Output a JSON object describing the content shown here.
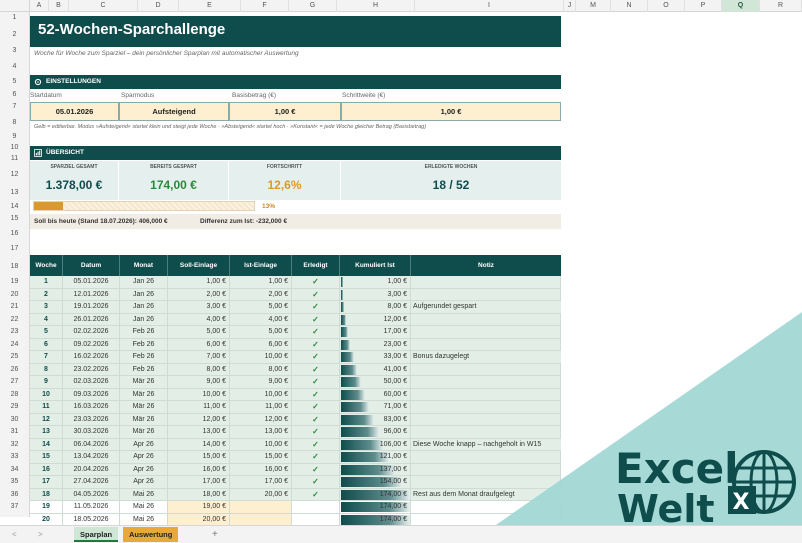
{
  "columns": [
    "A",
    "B",
    "C",
    "D",
    "E",
    "F",
    "G",
    "H",
    "I",
    "J",
    "M",
    "N",
    "O",
    "P",
    "Q",
    "R"
  ],
  "selected_column": "Q",
  "rows": [
    "1",
    "2",
    "3",
    "4",
    "5",
    "6",
    "7",
    "8",
    "9",
    "10",
    "11",
    "12",
    "13",
    "14",
    "15",
    "16",
    "17",
    "18",
    "19",
    "20",
    "21",
    "22",
    "23",
    "24",
    "25",
    "26",
    "27",
    "28",
    "29",
    "30",
    "31",
    "32",
    "33",
    "34",
    "35",
    "36",
    "37"
  ],
  "title": "52-Wochen-Sparchallenge",
  "subtitle": "Woche für Woche zum Sparziel – dein persönlicher Sparplan mit automatischer Auswertung",
  "settings": {
    "header": "EINSTELLUNGEN",
    "labels": {
      "start": "Startdatum",
      "mode": "Sparmodus",
      "base": "Basisbetrag (€)",
      "step": "Schrittweite (€)"
    },
    "values": {
      "start": "05.01.2026",
      "mode": "Aufsteigend",
      "base": "1,00 €",
      "step": "1,00 €"
    },
    "hint": "Gelb = editierbar. Modus »Aufsteigend« startet klein und steigt jede Woche · »Absteigend« startet hoch · »Konstant« = jede Woche gleicher Betrag (Basisbetrag)"
  },
  "overview": {
    "header": "ÜBERSICHT",
    "kpis": [
      {
        "label": "SPARZIEL GESAMT",
        "value": "1.378,00 €",
        "color": "#0f4c4c"
      },
      {
        "label": "BEREITS GESPART",
        "value": "174,00 €",
        "color": "#2a8a3a"
      },
      {
        "label": "FORTSCHRITT",
        "value": "12,6%",
        "color": "#d99a2b"
      },
      {
        "label": "ERLEDIGTE WOCHEN",
        "value": "18 / 52",
        "color": "#0f4c4c"
      }
    ],
    "progress": 0.13,
    "progress_label": "13%",
    "soll_text": "Soll bis heute (Stand 18.07.2026):  406,000 €",
    "diff_text": "Differenz zum Ist:  -232,000 €"
  },
  "table": {
    "headers": [
      "Woche",
      "Datum",
      "Monat",
      "Soll-Einlage",
      "Ist-Einlage",
      "Erledigt",
      "Kumuliert Ist",
      "Notiz"
    ],
    "rows": [
      {
        "week": "1",
        "date": "05.01.2026",
        "month": "Jan 26",
        "soll": "1,00 €",
        "ist": "1,00 €",
        "done": "✓",
        "cum": "1,00 €",
        "cum_value": 1,
        "note": ""
      },
      {
        "week": "2",
        "date": "12.01.2026",
        "month": "Jan 26",
        "soll": "2,00 €",
        "ist": "2,00 €",
        "done": "✓",
        "cum": "3,00 €",
        "cum_value": 3,
        "note": ""
      },
      {
        "week": "3",
        "date": "19.01.2026",
        "month": "Jan 26",
        "soll": "3,00 €",
        "ist": "5,00 €",
        "done": "✓",
        "cum": "8,00 €",
        "cum_value": 8,
        "note": "Aufgerundet gespart"
      },
      {
        "week": "4",
        "date": "26.01.2026",
        "month": "Jan 26",
        "soll": "4,00 €",
        "ist": "4,00 €",
        "done": "✓",
        "cum": "12,00 €",
        "cum_value": 12,
        "note": ""
      },
      {
        "week": "5",
        "date": "02.02.2026",
        "month": "Feb 26",
        "soll": "5,00 €",
        "ist": "5,00 €",
        "done": "✓",
        "cum": "17,00 €",
        "cum_value": 17,
        "note": ""
      },
      {
        "week": "6",
        "date": "09.02.2026",
        "month": "Feb 26",
        "soll": "6,00 €",
        "ist": "6,00 €",
        "done": "✓",
        "cum": "23,00 €",
        "cum_value": 23,
        "note": ""
      },
      {
        "week": "7",
        "date": "16.02.2026",
        "month": "Feb 26",
        "soll": "7,00 €",
        "ist": "10,00 €",
        "done": "✓",
        "cum": "33,00 €",
        "cum_value": 33,
        "note": "Bonus dazugelegt"
      },
      {
        "week": "8",
        "date": "23.02.2026",
        "month": "Feb 26",
        "soll": "8,00 €",
        "ist": "8,00 €",
        "done": "✓",
        "cum": "41,00 €",
        "cum_value": 41,
        "note": ""
      },
      {
        "week": "9",
        "date": "02.03.2026",
        "month": "Mär 26",
        "soll": "9,00 €",
        "ist": "9,00 €",
        "done": "✓",
        "cum": "50,00 €",
        "cum_value": 50,
        "note": ""
      },
      {
        "week": "10",
        "date": "09.03.2026",
        "month": "Mär 26",
        "soll": "10,00 €",
        "ist": "10,00 €",
        "done": "✓",
        "cum": "60,00 €",
        "cum_value": 60,
        "note": ""
      },
      {
        "week": "11",
        "date": "16.03.2026",
        "month": "Mär 26",
        "soll": "11,00 €",
        "ist": "11,00 €",
        "done": "✓",
        "cum": "71,00 €",
        "cum_value": 71,
        "note": ""
      },
      {
        "week": "12",
        "date": "23.03.2026",
        "month": "Mär 26",
        "soll": "12,00 €",
        "ist": "12,00 €",
        "done": "✓",
        "cum": "83,00 €",
        "cum_value": 83,
        "note": ""
      },
      {
        "week": "13",
        "date": "30.03.2026",
        "month": "Mär 26",
        "soll": "13,00 €",
        "ist": "13,00 €",
        "done": "✓",
        "cum": "96,00 €",
        "cum_value": 96,
        "note": ""
      },
      {
        "week": "14",
        "date": "06.04.2026",
        "month": "Apr 26",
        "soll": "14,00 €",
        "ist": "10,00 €",
        "done": "✓",
        "cum": "106,00 €",
        "cum_value": 106,
        "note": "Diese Woche knapp – nachgeholt in W15"
      },
      {
        "week": "15",
        "date": "13.04.2026",
        "month": "Apr 26",
        "soll": "15,00 €",
        "ist": "15,00 €",
        "done": "✓",
        "cum": "121,00 €",
        "cum_value": 121,
        "note": ""
      },
      {
        "week": "16",
        "date": "20.04.2026",
        "month": "Apr 26",
        "soll": "16,00 €",
        "ist": "16,00 €",
        "done": "✓",
        "cum": "137,00 €",
        "cum_value": 137,
        "note": ""
      },
      {
        "week": "17",
        "date": "27.04.2026",
        "month": "Apr 26",
        "soll": "17,00 €",
        "ist": "17,00 €",
        "done": "✓",
        "cum": "154,00 €",
        "cum_value": 154,
        "note": ""
      },
      {
        "week": "18",
        "date": "04.05.2026",
        "month": "Mai 26",
        "soll": "18,00 €",
        "ist": "20,00 €",
        "done": "✓",
        "cum": "174,00 €",
        "cum_value": 174,
        "note": "Rest aus dem Monat draufgelegt"
      },
      {
        "week": "19",
        "date": "11.05.2026",
        "month": "Mai 26",
        "soll": "19,00 €",
        "ist": "",
        "done": "",
        "cum": "174,00 €",
        "cum_value": 174,
        "note": ""
      },
      {
        "week": "20",
        "date": "18.05.2026",
        "month": "Mai 26",
        "soll": "20,00 €",
        "ist": "",
        "done": "",
        "cum": "174,00 €",
        "cum_value": 174,
        "note": ""
      }
    ]
  },
  "tabs": {
    "sheet1": "Sparplan",
    "sheet2": "Auswertung",
    "add": "+",
    "prev": "<",
    "next": ">"
  },
  "watermark": {
    "line1": "Excel",
    "line2": "Welt"
  }
}
